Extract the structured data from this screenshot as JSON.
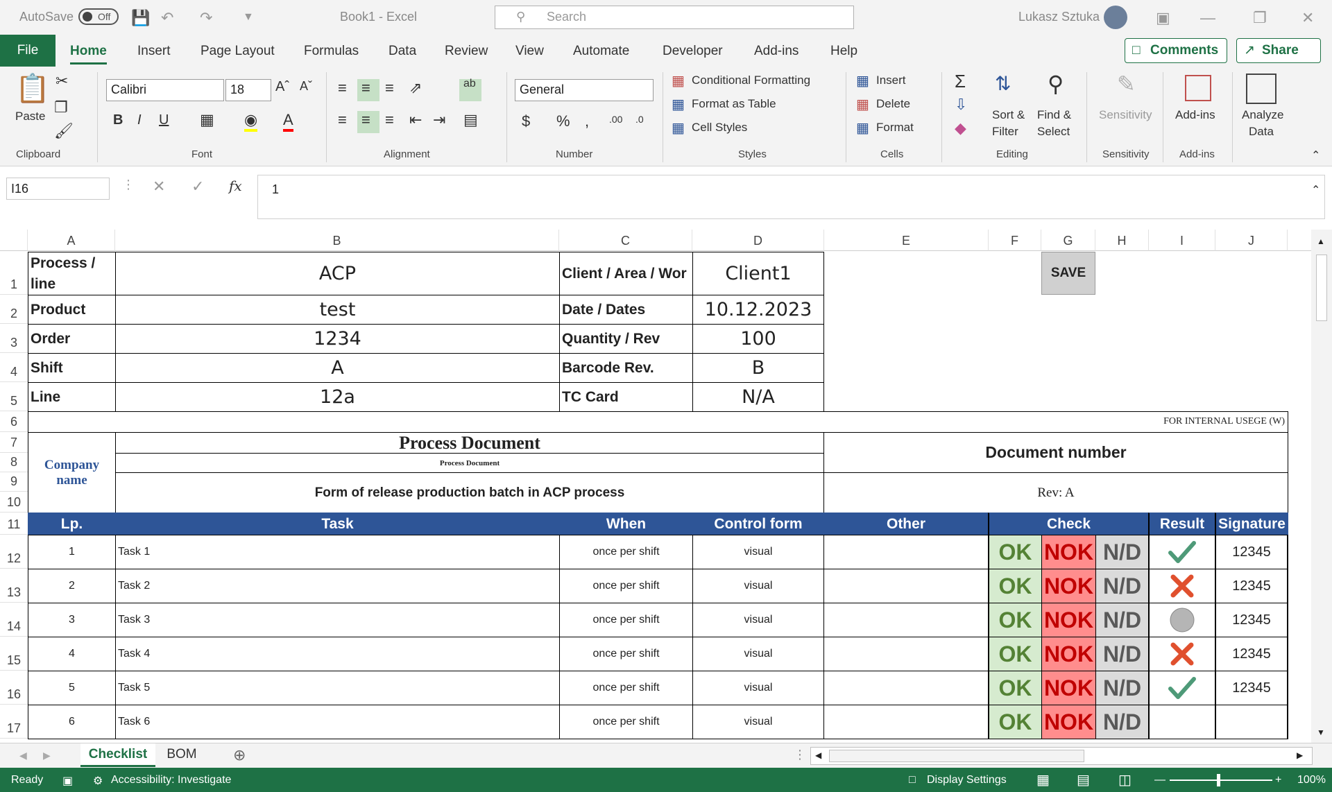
{
  "titlebar": {
    "autosave_label": "AutoSave",
    "autosave_state": "Off",
    "doc_title": "Book1  -  Excel",
    "search_placeholder": "Search",
    "user_name": "Lukasz Sztuka"
  },
  "ribbon_tabs": [
    "File",
    "Home",
    "Insert",
    "Page Layout",
    "Formulas",
    "Data",
    "Review",
    "View",
    "Automate",
    "Developer",
    "Add-ins",
    "Help"
  ],
  "active_tab": "Home",
  "comments_label": "Comments",
  "share_label": "Share",
  "ribbon": {
    "paste_label": "Paste",
    "font_name": "Calibri",
    "font_size": "18",
    "number_format": "General",
    "conditional_formatting": "Conditional Formatting",
    "format_as_table": "Format as Table",
    "cell_styles": "Cell Styles",
    "insert": "Insert",
    "delete": "Delete",
    "format": "Format",
    "sort_filter_1": "Sort &",
    "sort_filter_2": "Filter",
    "find_select_1": "Find &",
    "find_select_2": "Select",
    "sensitivity": "Sensitivity",
    "add_ins": "Add-ins",
    "analyze_1": "Analyze",
    "analyze_2": "Data",
    "groups": {
      "clipboard": "Clipboard",
      "font": "Font",
      "alignment": "Alignment",
      "number": "Number",
      "styles": "Styles",
      "cells": "Cells",
      "editing": "Editing",
      "sensitivity": "Sensitivity",
      "addins": "Add-ins"
    }
  },
  "formula_bar": {
    "name_box": "I16",
    "fx": "fx",
    "content": "1"
  },
  "columns": [
    "A",
    "B",
    "C",
    "D",
    "E",
    "F",
    "G",
    "H",
    "I",
    "J"
  ],
  "rows": [
    "1",
    "2",
    "3",
    "4",
    "5",
    "6",
    "7",
    "8",
    "9",
    "10",
    "11",
    "12",
    "13",
    "14",
    "15",
    "16",
    "17"
  ],
  "header": {
    "process_label": "Process / line",
    "process_value": "ACP",
    "client_label": "Client / Area / Wor",
    "client_value": "Client1",
    "product_label": "Product",
    "product_value": "test",
    "date_label": "Date / Dates",
    "date_value": "10.12.2023",
    "order_label": "Order",
    "order_value": "1234",
    "quantity_label": "Quantity / Rev",
    "quantity_value": "100",
    "shift_label": "Shift",
    "shift_value": "A",
    "barcode_label": "Barcode Rev.",
    "barcode_value": "B",
    "line_label": "Line",
    "line_value": "12a",
    "tc_label": "TC Card",
    "tc_value": "N/A",
    "save_button": "SAVE",
    "internal_usage": "FOR INTERNAL USEGE (W)",
    "company_name": "Company name",
    "doc_title": "Process Document",
    "doc_subtitle": "Process Document",
    "form_title": "Form of release production batch in ACP process",
    "doc_number_label": "Document number",
    "revision": "Rev: A"
  },
  "table": {
    "headers": {
      "lp": "Lp.",
      "task": "Task",
      "when": "When",
      "control": "Control form",
      "other": "Other",
      "check": "Check",
      "result": "Result",
      "signature": "Signature"
    },
    "ok_label": "OK",
    "nok_label": "NOK",
    "nd_label": "N/D",
    "rows": [
      {
        "lp": "1",
        "task": "Task 1",
        "when": "once per shift",
        "control": "visual",
        "result": "check",
        "signature": "12345"
      },
      {
        "lp": "2",
        "task": "Task 2",
        "when": "once per shift",
        "control": "visual",
        "result": "cross",
        "signature": "12345"
      },
      {
        "lp": "3",
        "task": "Task 3",
        "when": "once per shift",
        "control": "visual",
        "result": "circle",
        "signature": "12345"
      },
      {
        "lp": "4",
        "task": "Task 4",
        "when": "once per shift",
        "control": "visual",
        "result": "cross",
        "signature": "12345"
      },
      {
        "lp": "5",
        "task": "Task 5",
        "when": "once per shift",
        "control": "visual",
        "result": "check",
        "signature": "12345"
      },
      {
        "lp": "6",
        "task": "Task 6",
        "when": "once per shift",
        "control": "visual",
        "result": "none",
        "signature": ""
      }
    ]
  },
  "sheets": [
    "Checklist",
    "BOM"
  ],
  "active_sheet": "Checklist",
  "status": {
    "ready": "Ready",
    "accessibility": "Accessibility: Investigate",
    "display_settings": "Display Settings",
    "zoom": "100%"
  },
  "colors": {
    "accent": "#1e7145",
    "header_blue": "#2e5597",
    "ok_bg": "#d6ebcf",
    "nok_bg": "#ff8d8d",
    "nd_bg": "#dbdbdb"
  }
}
